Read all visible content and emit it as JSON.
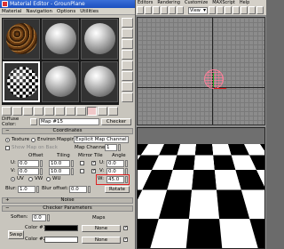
{
  "material_editor": {
    "title": "Material Editor - GrounPlane",
    "menu": [
      "Material",
      "Navigation",
      "Options",
      "Utilities"
    ],
    "diffuse_label": "Diffuse Color:",
    "map_label": "Map #15",
    "map_type": "Checker",
    "coordinates": {
      "rollout_title": "Coordinates",
      "texture_label": "Texture",
      "environ_label": "Environ",
      "mapping_label": "Mapping:",
      "mapping_value": "Explicit Map Channel",
      "show_map_label": "Show Map on Back",
      "map_channel_label": "Map Channel:",
      "map_channel_value": "1",
      "offset_label": "Offset",
      "tiling_label": "Tiling",
      "mirror_tile_label": "Mirror Tile",
      "angle_label": "Angle",
      "u_label": "U:",
      "v_label": "V:",
      "w_label": "W:",
      "u_offset": "0.0",
      "v_offset": "0.0",
      "u_tiling": "10.0",
      "v_tiling": "10.0",
      "u_angle": "0.0",
      "v_angle": "0.0",
      "w_angle": "45.0",
      "uv_label": "UV",
      "vw_label": "VW",
      "wu_label": "WU",
      "blur_label": "Blur:",
      "blur_value": "1.0",
      "blur_offset_label": "Blur offset:",
      "blur_offset_value": "0.0",
      "rotate_label": "Rotate"
    },
    "noise": {
      "rollout_title": "Noise"
    },
    "checker_parameters": {
      "rollout_title": "Checker Parameters",
      "soften_label": "Soften:",
      "soften_value": "0.0",
      "maps_label": "Maps",
      "swap_label": "Swap",
      "color1_label": "Color #1",
      "color2_label": "Color #2",
      "none_label": "None",
      "color1": "#000000",
      "color2": "#ffffff"
    }
  },
  "max_main": {
    "menu": [
      "Editors",
      "Rendering",
      "Customize",
      "MAXScript",
      "Help"
    ],
    "view_dropdown": "View"
  }
}
